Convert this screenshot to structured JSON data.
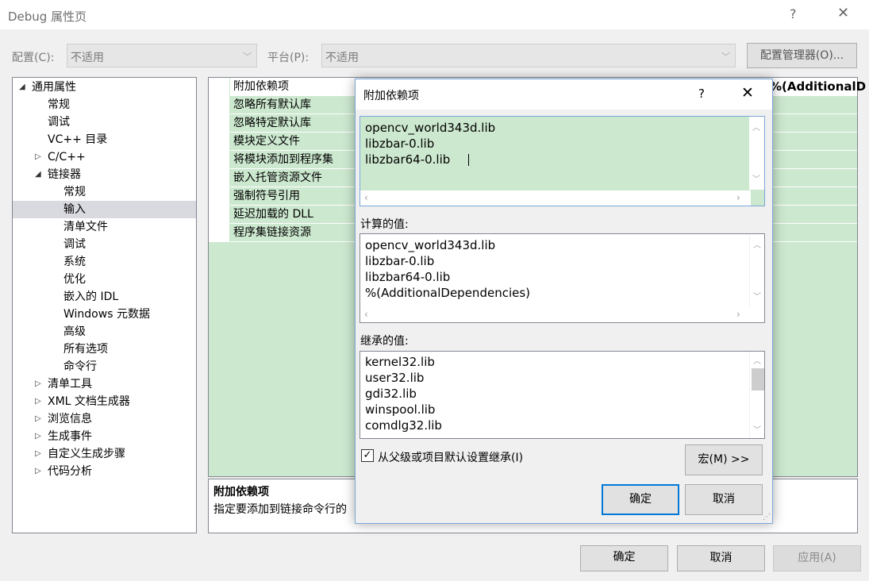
{
  "window": {
    "title": "Debug 属性页",
    "help": "?",
    "close": "✕"
  },
  "toolbar": {
    "config_label": "配置(C):",
    "config_value": "不适用",
    "platform_label": "平台(P):",
    "platform_value": "不适用",
    "config_manager": "配置管理器(O)..."
  },
  "tree": [
    {
      "label": "通用属性",
      "twisty": "◢",
      "level": 0
    },
    {
      "label": "常规",
      "twisty": "",
      "level": 1
    },
    {
      "label": "调试",
      "twisty": "",
      "level": 1
    },
    {
      "label": "VC++ 目录",
      "twisty": "",
      "level": 1
    },
    {
      "label": "C/C++",
      "twisty": "▷",
      "level": 1
    },
    {
      "label": "链接器",
      "twisty": "◢",
      "level": 1
    },
    {
      "label": "常规",
      "twisty": "",
      "level": 2
    },
    {
      "label": "输入",
      "twisty": "",
      "level": 2,
      "selected": true
    },
    {
      "label": "清单文件",
      "twisty": "",
      "level": 2
    },
    {
      "label": "调试",
      "twisty": "",
      "level": 2
    },
    {
      "label": "系统",
      "twisty": "",
      "level": 2
    },
    {
      "label": "优化",
      "twisty": "",
      "level": 2
    },
    {
      "label": "嵌入的 IDL",
      "twisty": "",
      "level": 2
    },
    {
      "label": "Windows 元数据",
      "twisty": "",
      "level": 2
    },
    {
      "label": "高级",
      "twisty": "",
      "level": 2
    },
    {
      "label": "所有选项",
      "twisty": "",
      "level": 2
    },
    {
      "label": "命令行",
      "twisty": "",
      "level": 2
    },
    {
      "label": "清单工具",
      "twisty": "▷",
      "level": 1
    },
    {
      "label": "XML 文档生成器",
      "twisty": "▷",
      "level": 1
    },
    {
      "label": "浏览信息",
      "twisty": "▷",
      "level": 1
    },
    {
      "label": "生成事件",
      "twisty": "▷",
      "level": 1
    },
    {
      "label": "自定义生成步骤",
      "twisty": "▷",
      "level": 1
    },
    {
      "label": "代码分析",
      "twisty": "▷",
      "level": 1
    }
  ],
  "grid": {
    "rows": [
      "附加依赖项",
      "忽略所有默认库",
      "忽略特定默认库",
      "模块定义文件",
      "将模块添加到程序集",
      "嵌入托管资源文件",
      "强制符号引用",
      "延迟加载的 DLL",
      "程序集链接资源"
    ],
    "first_value": "%(AdditionalD"
  },
  "description": {
    "title": "附加依赖项",
    "text": "指定要添加到链接命令行的"
  },
  "dialog": {
    "title": "附加依赖项",
    "help": "?",
    "close": "✕",
    "edit_lines": [
      "opencv_world343d.lib",
      "libzbar-0.lib",
      "libzbar64-0.lib"
    ],
    "computed_label": "计算的值:",
    "computed_lines": [
      "opencv_world343d.lib",
      "libzbar-0.lib",
      "libzbar64-0.lib",
      "%(AdditionalDependencies)"
    ],
    "inherited_label": "继承的值:",
    "inherited_lines": [
      "kernel32.lib",
      "user32.lib",
      "gdi32.lib",
      "winspool.lib",
      "comdlg32.lib"
    ],
    "inherit_checkbox": "从父级或项目默认设置继承(I)",
    "inherit_checked": true,
    "macros_button": "宏(M) >>",
    "ok_button": "确定",
    "cancel_button": "取消"
  },
  "footer": {
    "ok": "确定",
    "cancel": "取消",
    "apply": "应用(A)"
  }
}
